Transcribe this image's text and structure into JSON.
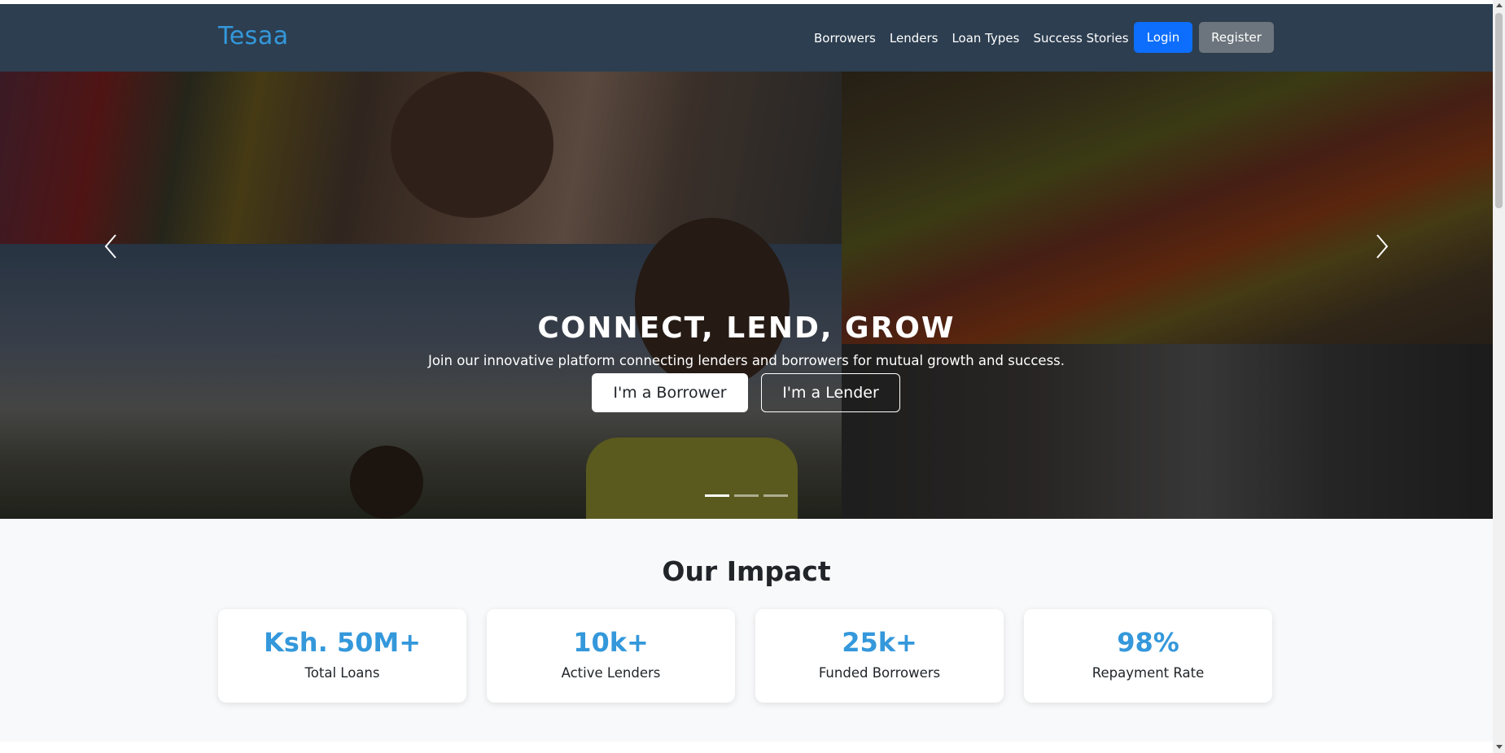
{
  "colors": {
    "navbar_bg": "#2c3e50",
    "brand": "#3498db",
    "login_bg": "#0d6efd",
    "register_bg": "#6c757d",
    "impact_value": "#3498db",
    "impact_bg": "#f8f9fa"
  },
  "navbar": {
    "brand": "Tesaa",
    "links": [
      "Borrowers",
      "Lenders",
      "Loan Types",
      "Success Stories"
    ],
    "login_label": "Login",
    "register_label": "Register"
  },
  "hero": {
    "title": "CONNECT, LEND, GROW",
    "subtitle": "Join our innovative platform connecting lenders and borrowers for mutual growth and success.",
    "borrower_button": "I'm a Borrower",
    "lender_button": "I'm a Lender",
    "prev_icon": "chevron-left-icon",
    "next_icon": "chevron-right-icon",
    "slide_count": 3,
    "active_slide": 1
  },
  "impact": {
    "title": "Our Impact",
    "stats": [
      {
        "value": "Ksh. 50M+",
        "label": "Total Loans"
      },
      {
        "value": "10k+",
        "label": "Active Lenders"
      },
      {
        "value": "25k+",
        "label": "Funded Borrowers"
      },
      {
        "value": "98%",
        "label": "Repayment Rate"
      }
    ]
  }
}
